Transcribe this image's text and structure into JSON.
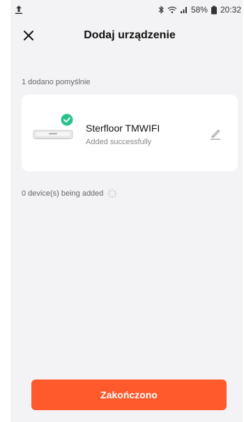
{
  "status_bar": {
    "left_icon": "upload-arrow-icon",
    "battery_percent": "58%",
    "time": "20:32"
  },
  "header": {
    "title": "Dodaj urządzenie",
    "close_icon": "close-icon"
  },
  "section": {
    "label": "1 dodano pomyślnie"
  },
  "device": {
    "name": "Sterfloor TMWIFI",
    "status": "Added successfully",
    "status_icon": "check-circle-icon",
    "edit_icon": "pencil-icon"
  },
  "adding": {
    "label": "0 device(s) being added",
    "icon": "loading-spinner-icon"
  },
  "footer": {
    "finish_label": "Zakończono"
  },
  "colors": {
    "accent": "#ff5a2b",
    "success": "#2ac28a",
    "background": "#f3f3f5"
  }
}
